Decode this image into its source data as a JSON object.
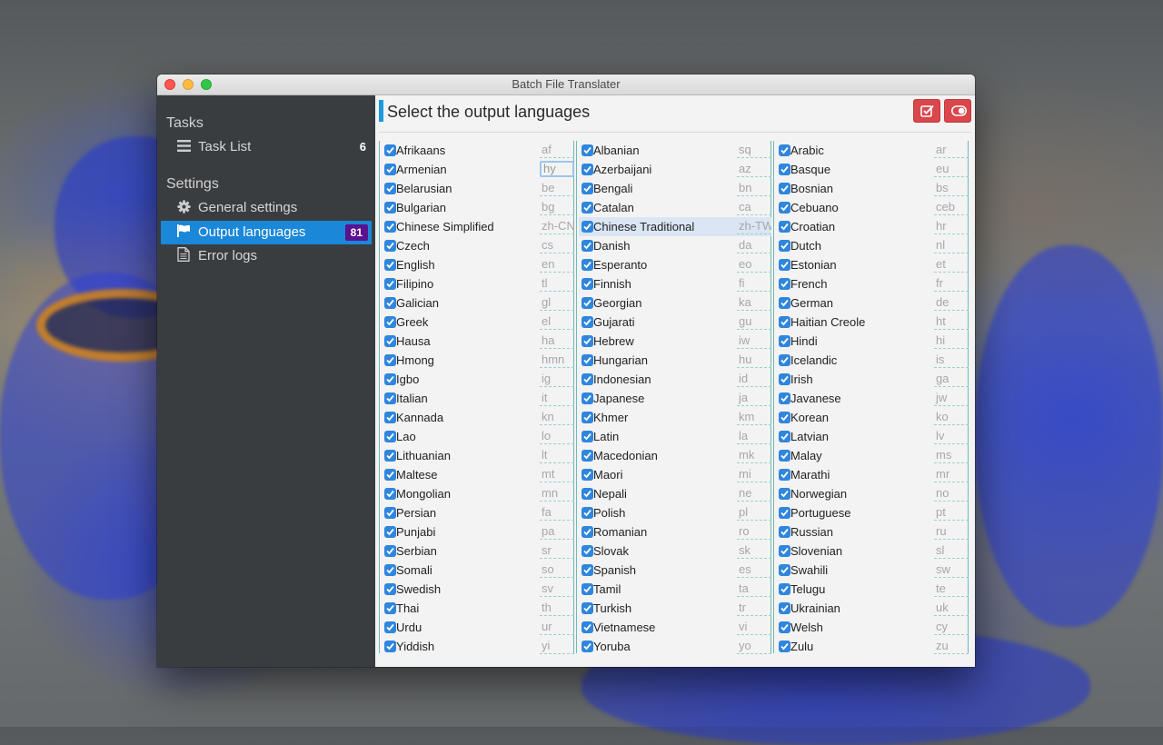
{
  "window": {
    "title": "Batch File Translater"
  },
  "sidebar": {
    "tasks_header": "Tasks",
    "task_list": {
      "label": "Task List",
      "count": "6"
    },
    "settings_header": "Settings",
    "general_settings": {
      "label": "General settings"
    },
    "output_languages": {
      "label": "Output languages",
      "badge": "81"
    },
    "error_logs": {
      "label": "Error logs"
    }
  },
  "main": {
    "title": "Select the output languages"
  },
  "languages": [
    [
      {
        "name": "Afrikaans",
        "code": "af"
      },
      {
        "name": "Armenian",
        "code": "hy"
      },
      {
        "name": "Belarusian",
        "code": "be"
      },
      {
        "name": "Bulgarian",
        "code": "bg"
      },
      {
        "name": "Chinese Simplified",
        "code": "zh-CN"
      },
      {
        "name": "Czech",
        "code": "cs"
      },
      {
        "name": "English",
        "code": "en"
      },
      {
        "name": "Filipino",
        "code": "tl"
      },
      {
        "name": "Galician",
        "code": "gl"
      },
      {
        "name": "Greek",
        "code": "el"
      },
      {
        "name": "Hausa",
        "code": "ha"
      },
      {
        "name": "Hmong",
        "code": "hmn"
      },
      {
        "name": "Igbo",
        "code": "ig"
      },
      {
        "name": "Italian",
        "code": "it"
      },
      {
        "name": "Kannada",
        "code": "kn"
      },
      {
        "name": "Lao",
        "code": "lo"
      },
      {
        "name": "Lithuanian",
        "code": "lt"
      },
      {
        "name": "Maltese",
        "code": "mt"
      },
      {
        "name": "Mongolian",
        "code": "mn"
      },
      {
        "name": "Persian",
        "code": "fa"
      },
      {
        "name": "Punjabi",
        "code": "pa"
      },
      {
        "name": "Serbian",
        "code": "sr"
      },
      {
        "name": "Somali",
        "code": "so"
      },
      {
        "name": "Swedish",
        "code": "sv"
      },
      {
        "name": "Thai",
        "code": "th"
      },
      {
        "name": "Urdu",
        "code": "ur"
      },
      {
        "name": "Yiddish",
        "code": "yi"
      }
    ],
    [
      {
        "name": "Albanian",
        "code": "sq"
      },
      {
        "name": "Azerbaijani",
        "code": "az"
      },
      {
        "name": "Bengali",
        "code": "bn"
      },
      {
        "name": "Catalan",
        "code": "ca"
      },
      {
        "name": "Chinese Traditional",
        "code": "zh-TW"
      },
      {
        "name": "Danish",
        "code": "da"
      },
      {
        "name": "Esperanto",
        "code": "eo"
      },
      {
        "name": "Finnish",
        "code": "fi"
      },
      {
        "name": "Georgian",
        "code": "ka"
      },
      {
        "name": "Gujarati",
        "code": "gu"
      },
      {
        "name": "Hebrew",
        "code": "iw"
      },
      {
        "name": "Hungarian",
        "code": "hu"
      },
      {
        "name": "Indonesian",
        "code": "id"
      },
      {
        "name": "Japanese",
        "code": "ja"
      },
      {
        "name": "Khmer",
        "code": "km"
      },
      {
        "name": "Latin",
        "code": "la"
      },
      {
        "name": "Macedonian",
        "code": "mk"
      },
      {
        "name": "Maori",
        "code": "mi"
      },
      {
        "name": "Nepali",
        "code": "ne"
      },
      {
        "name": "Polish",
        "code": "pl"
      },
      {
        "name": "Romanian",
        "code": "ro"
      },
      {
        "name": "Slovak",
        "code": "sk"
      },
      {
        "name": "Spanish",
        "code": "es"
      },
      {
        "name": "Tamil",
        "code": "ta"
      },
      {
        "name": "Turkish",
        "code": "tr"
      },
      {
        "name": "Vietnamese",
        "code": "vi"
      },
      {
        "name": "Yoruba",
        "code": "yo"
      }
    ],
    [
      {
        "name": "Arabic",
        "code": "ar"
      },
      {
        "name": "Basque",
        "code": "eu"
      },
      {
        "name": "Bosnian",
        "code": "bs"
      },
      {
        "name": "Cebuano",
        "code": "ceb"
      },
      {
        "name": "Croatian",
        "code": "hr"
      },
      {
        "name": "Dutch",
        "code": "nl"
      },
      {
        "name": "Estonian",
        "code": "et"
      },
      {
        "name": "French",
        "code": "fr"
      },
      {
        "name": "German",
        "code": "de"
      },
      {
        "name": "Haitian Creole",
        "code": "ht"
      },
      {
        "name": "Hindi",
        "code": "hi"
      },
      {
        "name": "Icelandic",
        "code": "is"
      },
      {
        "name": "Irish",
        "code": "ga"
      },
      {
        "name": "Javanese",
        "code": "jw"
      },
      {
        "name": "Korean",
        "code": "ko"
      },
      {
        "name": "Latvian",
        "code": "lv"
      },
      {
        "name": "Malay",
        "code": "ms"
      },
      {
        "name": "Marathi",
        "code": "mr"
      },
      {
        "name": "Norwegian",
        "code": "no"
      },
      {
        "name": "Portuguese",
        "code": "pt"
      },
      {
        "name": "Russian",
        "code": "ru"
      },
      {
        "name": "Slovenian",
        "code": "sl"
      },
      {
        "name": "Swahili",
        "code": "sw"
      },
      {
        "name": "Telugu",
        "code": "te"
      },
      {
        "name": "Ukrainian",
        "code": "uk"
      },
      {
        "name": "Welsh",
        "code": "cy"
      },
      {
        "name": "Zulu",
        "code": "zu"
      }
    ]
  ],
  "state": {
    "selected_language": "Chinese Traditional",
    "focused_code_field": "Armenian",
    "all_checked": true
  },
  "colors": {
    "accent": "#1a87d8",
    "badge": "#5b1090",
    "danger_button": "#d9464b",
    "sidebar_bg": "#3a3d40"
  },
  "icons": {
    "task_list": "list-icon",
    "general_settings": "gear-icon",
    "output_languages": "flag-icon",
    "error_logs": "document-icon",
    "select_all": "checkbox-icon",
    "toggle": "toggle-icon"
  }
}
